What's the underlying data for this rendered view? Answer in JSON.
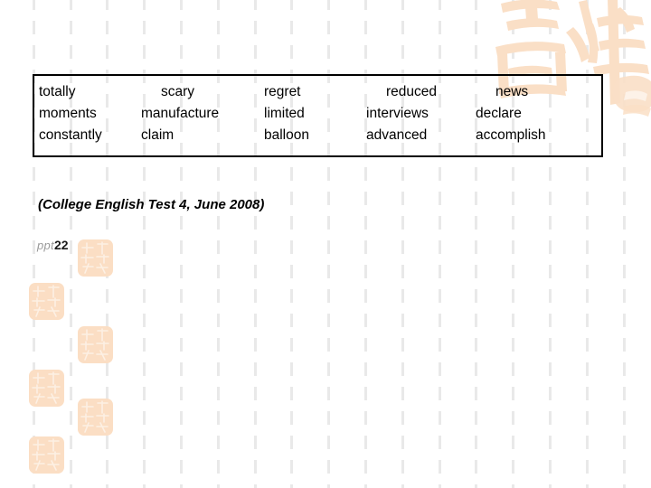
{
  "slide": {
    "word_box": {
      "columns": [
        {
          "words": [
            "totally",
            "moments",
            "constantly"
          ],
          "first_word_indented": false
        },
        {
          "words": [
            "scary",
            "manufacture",
            "claim"
          ],
          "first_word_indented": true
        },
        {
          "words": [
            "regret",
            "limited",
            "balloon"
          ],
          "first_word_indented": false
        },
        {
          "words": [
            "reduced",
            "interviews",
            "advanced"
          ],
          "first_word_indented": true
        },
        {
          "words": [
            "news",
            "declare",
            "accomplish"
          ],
          "first_word_indented": true
        }
      ]
    },
    "citation": "(College English Test 4, June 2008)",
    "marker": {
      "prefix": "ppt",
      "number": "22"
    },
    "watermark": {
      "name": "seal-script-jixiang-watermark",
      "characters": "吉祥"
    },
    "colors": {
      "text": "#000000",
      "box_border": "#000000",
      "decorative_square": "#fbdec4",
      "watermark": "#fadfc6",
      "grid_dash": "#e9e9e9",
      "marker_prefix": "#9a9a9a",
      "marker_number": "#1a1a1a",
      "background": "#ffffff"
    }
  }
}
